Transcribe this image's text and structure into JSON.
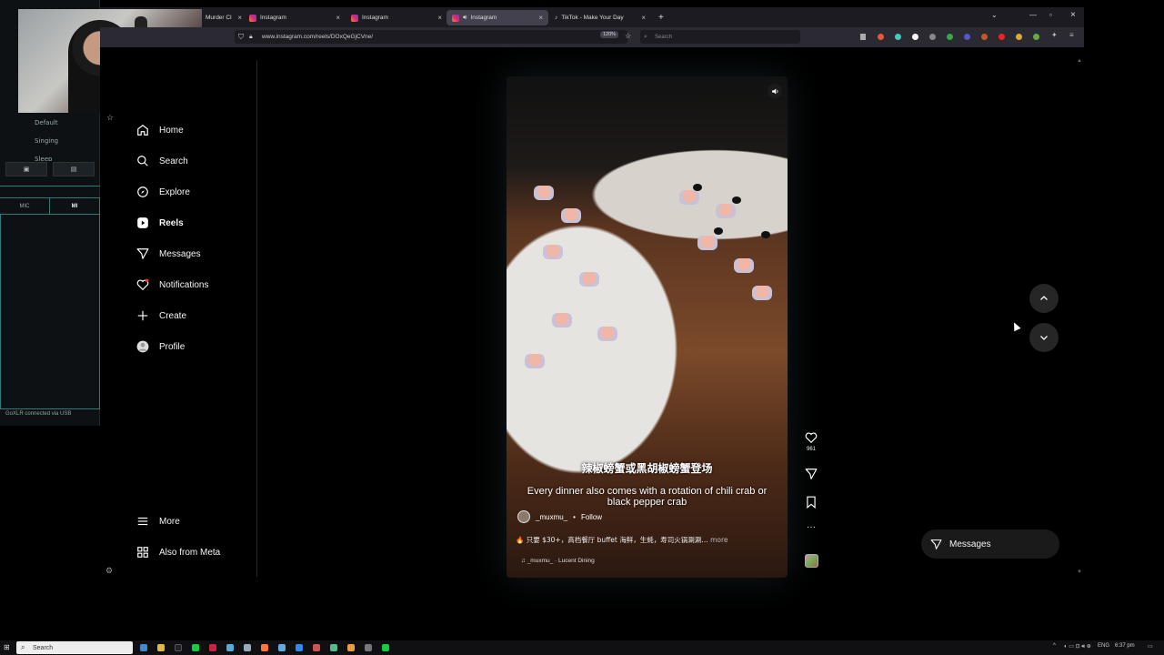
{
  "stream_panel": {
    "options": [
      "Default",
      "Singing",
      "Sleep"
    ],
    "mic_tabs": [
      "MIC",
      "MI"
    ],
    "connection": "GoXLR connected via USB"
  },
  "browser": {
    "tabs": [
      {
        "label": "Murder Cl"
      },
      {
        "label": "Instagram"
      },
      {
        "label": "Instagram"
      },
      {
        "label": "Instagram"
      },
      {
        "label": "TikTok - Make Your Day"
      }
    ],
    "url": "www.instagram.com/reels/DOxQeGjCVne/",
    "zoom": "120%",
    "search_placeholder": "Search"
  },
  "nav": {
    "items": [
      {
        "label": "Home",
        "icon": "home-icon"
      },
      {
        "label": "Search",
        "icon": "search-icon"
      },
      {
        "label": "Explore",
        "icon": "compass-icon"
      },
      {
        "label": "Reels",
        "icon": "reels-icon"
      },
      {
        "label": "Messages",
        "icon": "paper-plane-icon"
      },
      {
        "label": "Notifications",
        "icon": "heart-icon"
      },
      {
        "label": "Create",
        "icon": "plus-icon"
      },
      {
        "label": "Profile",
        "icon": "avatar-icon"
      }
    ],
    "more": "More",
    "meta": "Also from Meta"
  },
  "reel": {
    "caption_cn": "辣椒螃蟹或黑胡椒螃蟹登场",
    "caption_en": "Every dinner also comes with a rotation of chili crab or black pepper crab",
    "username": "_muxmu_",
    "follow": "Follow",
    "description": "🔥 只要 $30+，高档餐厅 buffet 海鲜，生蚝，寿司火锅涮涮…",
    "more": "more",
    "audio": "_muxmu_ · Lucent Dining",
    "likes": "961"
  },
  "messages_pill": "Messages",
  "taskbar": {
    "search_placeholder": "Search",
    "lang": "ENG",
    "time": "6:37 pm"
  }
}
